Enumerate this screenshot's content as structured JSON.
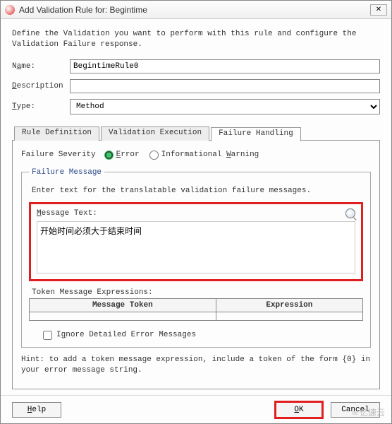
{
  "window": {
    "title": "Add Validation Rule for: Begintime",
    "close_glyph": "✕"
  },
  "intro": "Define the Validation you want to perform with this rule and configure the Validation Failure response.",
  "labels": {
    "name_pre": "N",
    "name_ul": "a",
    "name_post": "me:",
    "desc_pre": "",
    "desc_ul": "D",
    "desc_post": "escription",
    "type_pre": "",
    "type_ul": "T",
    "type_post": "ype:"
  },
  "form": {
    "name_value": "BegintimeRule0",
    "description_value": "",
    "type_value": "Method"
  },
  "tabs": {
    "rule_def": "Rule Definition",
    "val_exec": "Validation Execution",
    "fail_hand": "Failure Handling"
  },
  "severity": {
    "label": "Failure Severity",
    "error_pre": "",
    "error_ul": "E",
    "error_post": "rror",
    "warn_pre": "Informational ",
    "warn_ul": "W",
    "warn_post": "arning"
  },
  "failure_message": {
    "legend": "Failure Message",
    "hint": "Enter text for the translatable validation failure messages.",
    "msg_label_ul": "M",
    "msg_label_post": "essage Text:",
    "msg_value": "开始时间必须大于结束时间"
  },
  "tokens": {
    "heading": "Token Message Expressions:",
    "col_token": "Message Token",
    "col_expr": "Expression"
  },
  "ignore": {
    "pre": "I",
    "ul": "g",
    "post": "nore Detailed Error Messages"
  },
  "hint": "Hint: to add a token message expression, include a token of the form {0} in your error message string.",
  "buttons": {
    "help_ul": "H",
    "help_post": "elp",
    "ok_ul": "O",
    "ok_post": "K",
    "cancel": "Cancel"
  },
  "watermark": "亿速云"
}
